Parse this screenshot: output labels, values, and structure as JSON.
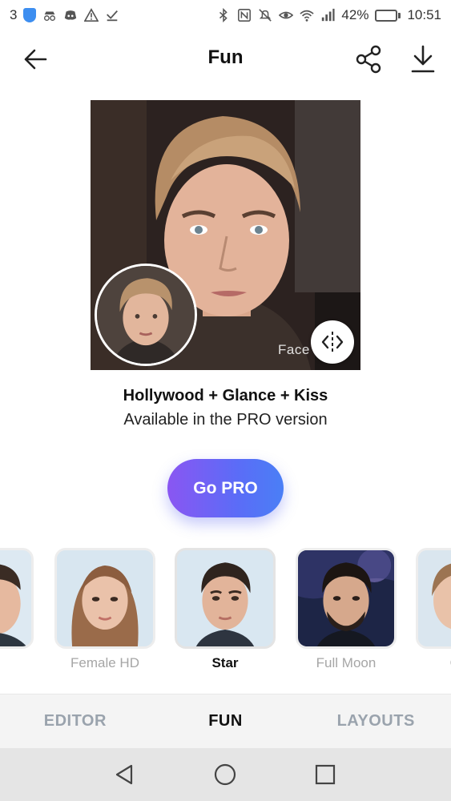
{
  "status_bar": {
    "notification_count": "3",
    "battery_percent": "42%",
    "battery_level": 0.42,
    "time": "10:51",
    "left_icons": [
      "shield-icon",
      "incognito-icon",
      "discord-icon",
      "warning-icon",
      "checkmark-icon"
    ],
    "right_icons": [
      "bluetooth-icon",
      "nfc-icon",
      "mute-icon",
      "eye-icon",
      "wifi-icon",
      "signal-icon",
      "battery-icon"
    ]
  },
  "header": {
    "title": "Fun",
    "icons": [
      "back-arrow-icon",
      "share-icon",
      "download-icon"
    ]
  },
  "preview": {
    "watermark": "Face",
    "compare_icon": "compare-arrows-icon"
  },
  "filter_info": {
    "name": "Hollywood + Glance + Kiss",
    "note": "Available in the PRO version"
  },
  "go_pro": {
    "label": "Go PRO"
  },
  "filters": [
    {
      "label": "e",
      "selected": false
    },
    {
      "label": "Female HD",
      "selected": false
    },
    {
      "label": "Star",
      "selected": true
    },
    {
      "label": "Full Moon",
      "selected": false
    },
    {
      "label": "Genc",
      "selected": false
    }
  ],
  "tabs": [
    {
      "label": "EDITOR",
      "active": false
    },
    {
      "label": "FUN",
      "active": true
    },
    {
      "label": "LAYOUTS",
      "active": false
    }
  ],
  "nav": {
    "icons": [
      "nav-back-icon",
      "nav-home-icon",
      "nav-recents-icon"
    ]
  },
  "colors": {
    "accent_gradient_start": "#8a56f2",
    "accent_gradient_end": "#4a7ff6",
    "tab_inactive": "#9aa3ad",
    "label_inactive": "#a6a6a6"
  }
}
